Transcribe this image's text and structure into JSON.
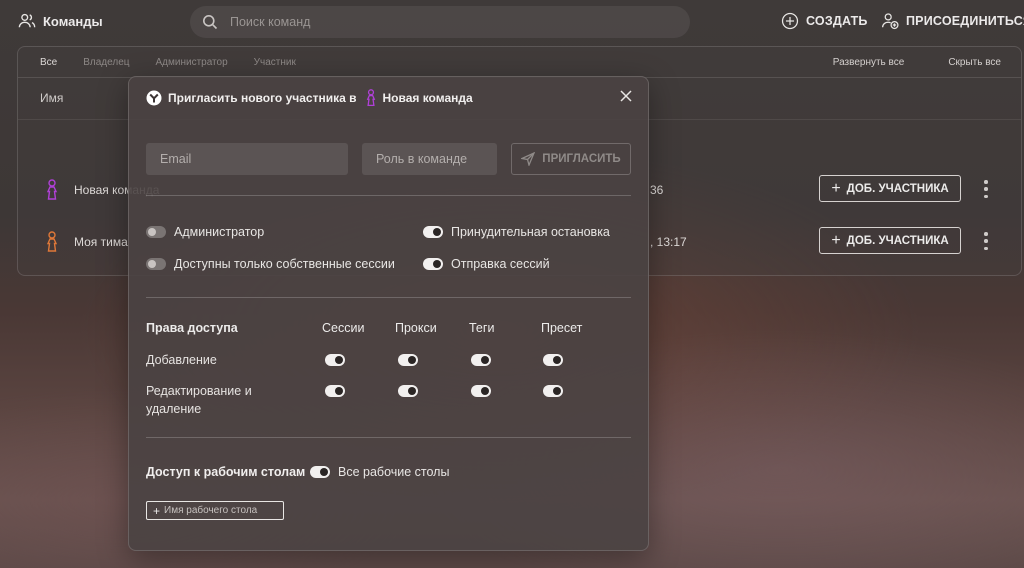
{
  "header": {
    "title": "Команды",
    "search_placeholder": "Поиск команд",
    "create_label": "СОЗДАТЬ",
    "join_label": "ПРИСОЕДИНИТЬСЯ"
  },
  "panel": {
    "filters": [
      "Все",
      "Владелец",
      "Администратор",
      "Участник"
    ],
    "active_filter": "Все",
    "expand_all": "Развернуть все",
    "collapse_all": "Скрыть все",
    "column_name": "Имя",
    "teams": [
      {
        "name": "Новая команда",
        "date_fragment": "36",
        "add_label": "ДОБ. УЧАСТНИКА",
        "icon_color": "#b040d8"
      },
      {
        "name": "Моя тима",
        "date_fragment": ", 13:17",
        "add_label": "ДОБ. УЧАСТНИКА",
        "icon_color": "#e07838"
      }
    ]
  },
  "modal": {
    "title_prefix": "Пригласить нового участника в",
    "team_name": "Новая команда",
    "team_icon_color": "#b040d8",
    "email_placeholder": "Email",
    "role_placeholder": "Роль в команде",
    "invite_label": "ПРИГЛАСИТЬ",
    "options": [
      {
        "label": "Администратор",
        "on": false
      },
      {
        "label": "Доступны только собственные сессии",
        "on": false
      },
      {
        "label": "Принудительная остановка",
        "on": true
      },
      {
        "label": "Отправка сессий",
        "on": true
      }
    ],
    "permissions": {
      "header": "Права доступа",
      "columns": [
        "Сессии",
        "Прокси",
        "Теги",
        "Пресет"
      ],
      "rows": [
        {
          "label": "Добавление",
          "values": [
            true,
            true,
            true,
            true
          ]
        },
        {
          "label": "Редактирование и удаление",
          "values": [
            true,
            true,
            true,
            true
          ]
        }
      ]
    },
    "workspace": {
      "label": "Доступ к рабочим столам",
      "all_label": "Все рабочие столы",
      "all_on": true,
      "input_placeholder": "Имя рабочего стола"
    }
  }
}
